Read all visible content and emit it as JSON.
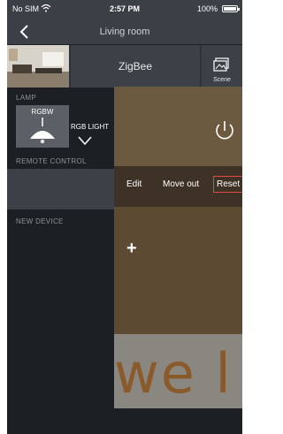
{
  "status_bar": {
    "carrier": "No SIM",
    "time": "2:57 PM",
    "battery": "100%"
  },
  "nav": {
    "title": "Living room",
    "back_icon": "chevron-left-icon"
  },
  "room": {
    "gateway": "ZigBee",
    "scene_label": "Scene"
  },
  "sections": {
    "lamp": "LAMP",
    "remote": "REMOTE CONTROL",
    "new_device": "NEW DEVICE"
  },
  "lamp": {
    "name": "RGBW",
    "device": "RGB LIGHT"
  },
  "actions": {
    "edit": "Edit",
    "move_out": "Move out",
    "reset": "Reset"
  },
  "add_symbol": "+",
  "watermark": "we l",
  "colors": {
    "accent_red": "#e04a3f",
    "panel": "#3b4147",
    "overlay": "#6b5a3f"
  }
}
